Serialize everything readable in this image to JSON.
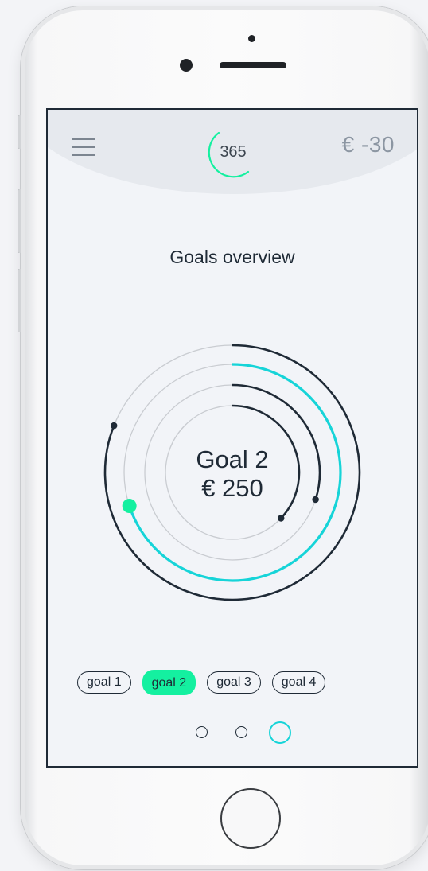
{
  "header": {
    "logo_text": "365",
    "balance": "€ -30"
  },
  "main": {
    "title": "Goals overview",
    "selected_goal": {
      "name": "Goal 2",
      "amount": "€ 250"
    },
    "goal_progress": [
      {
        "goal": "goal 1",
        "fraction": 0.81
      },
      {
        "goal": "goal 2",
        "fraction": 0.7
      },
      {
        "goal": "goal 3",
        "fraction": 0.3
      },
      {
        "goal": "goal 4",
        "fraction": 0.37
      }
    ],
    "goal_chips": [
      {
        "label": "goal 1",
        "active": false
      },
      {
        "label": "goal 2",
        "active": true
      },
      {
        "label": "goal 3",
        "active": false
      },
      {
        "label": "goal 4",
        "active": false
      }
    ],
    "pagination": {
      "pages": 3,
      "current": 3
    }
  },
  "colors": {
    "navy": "#1f2a36",
    "cyan": "#16d4d8",
    "green": "#14f0a0",
    "track": "#c9ccd1"
  }
}
